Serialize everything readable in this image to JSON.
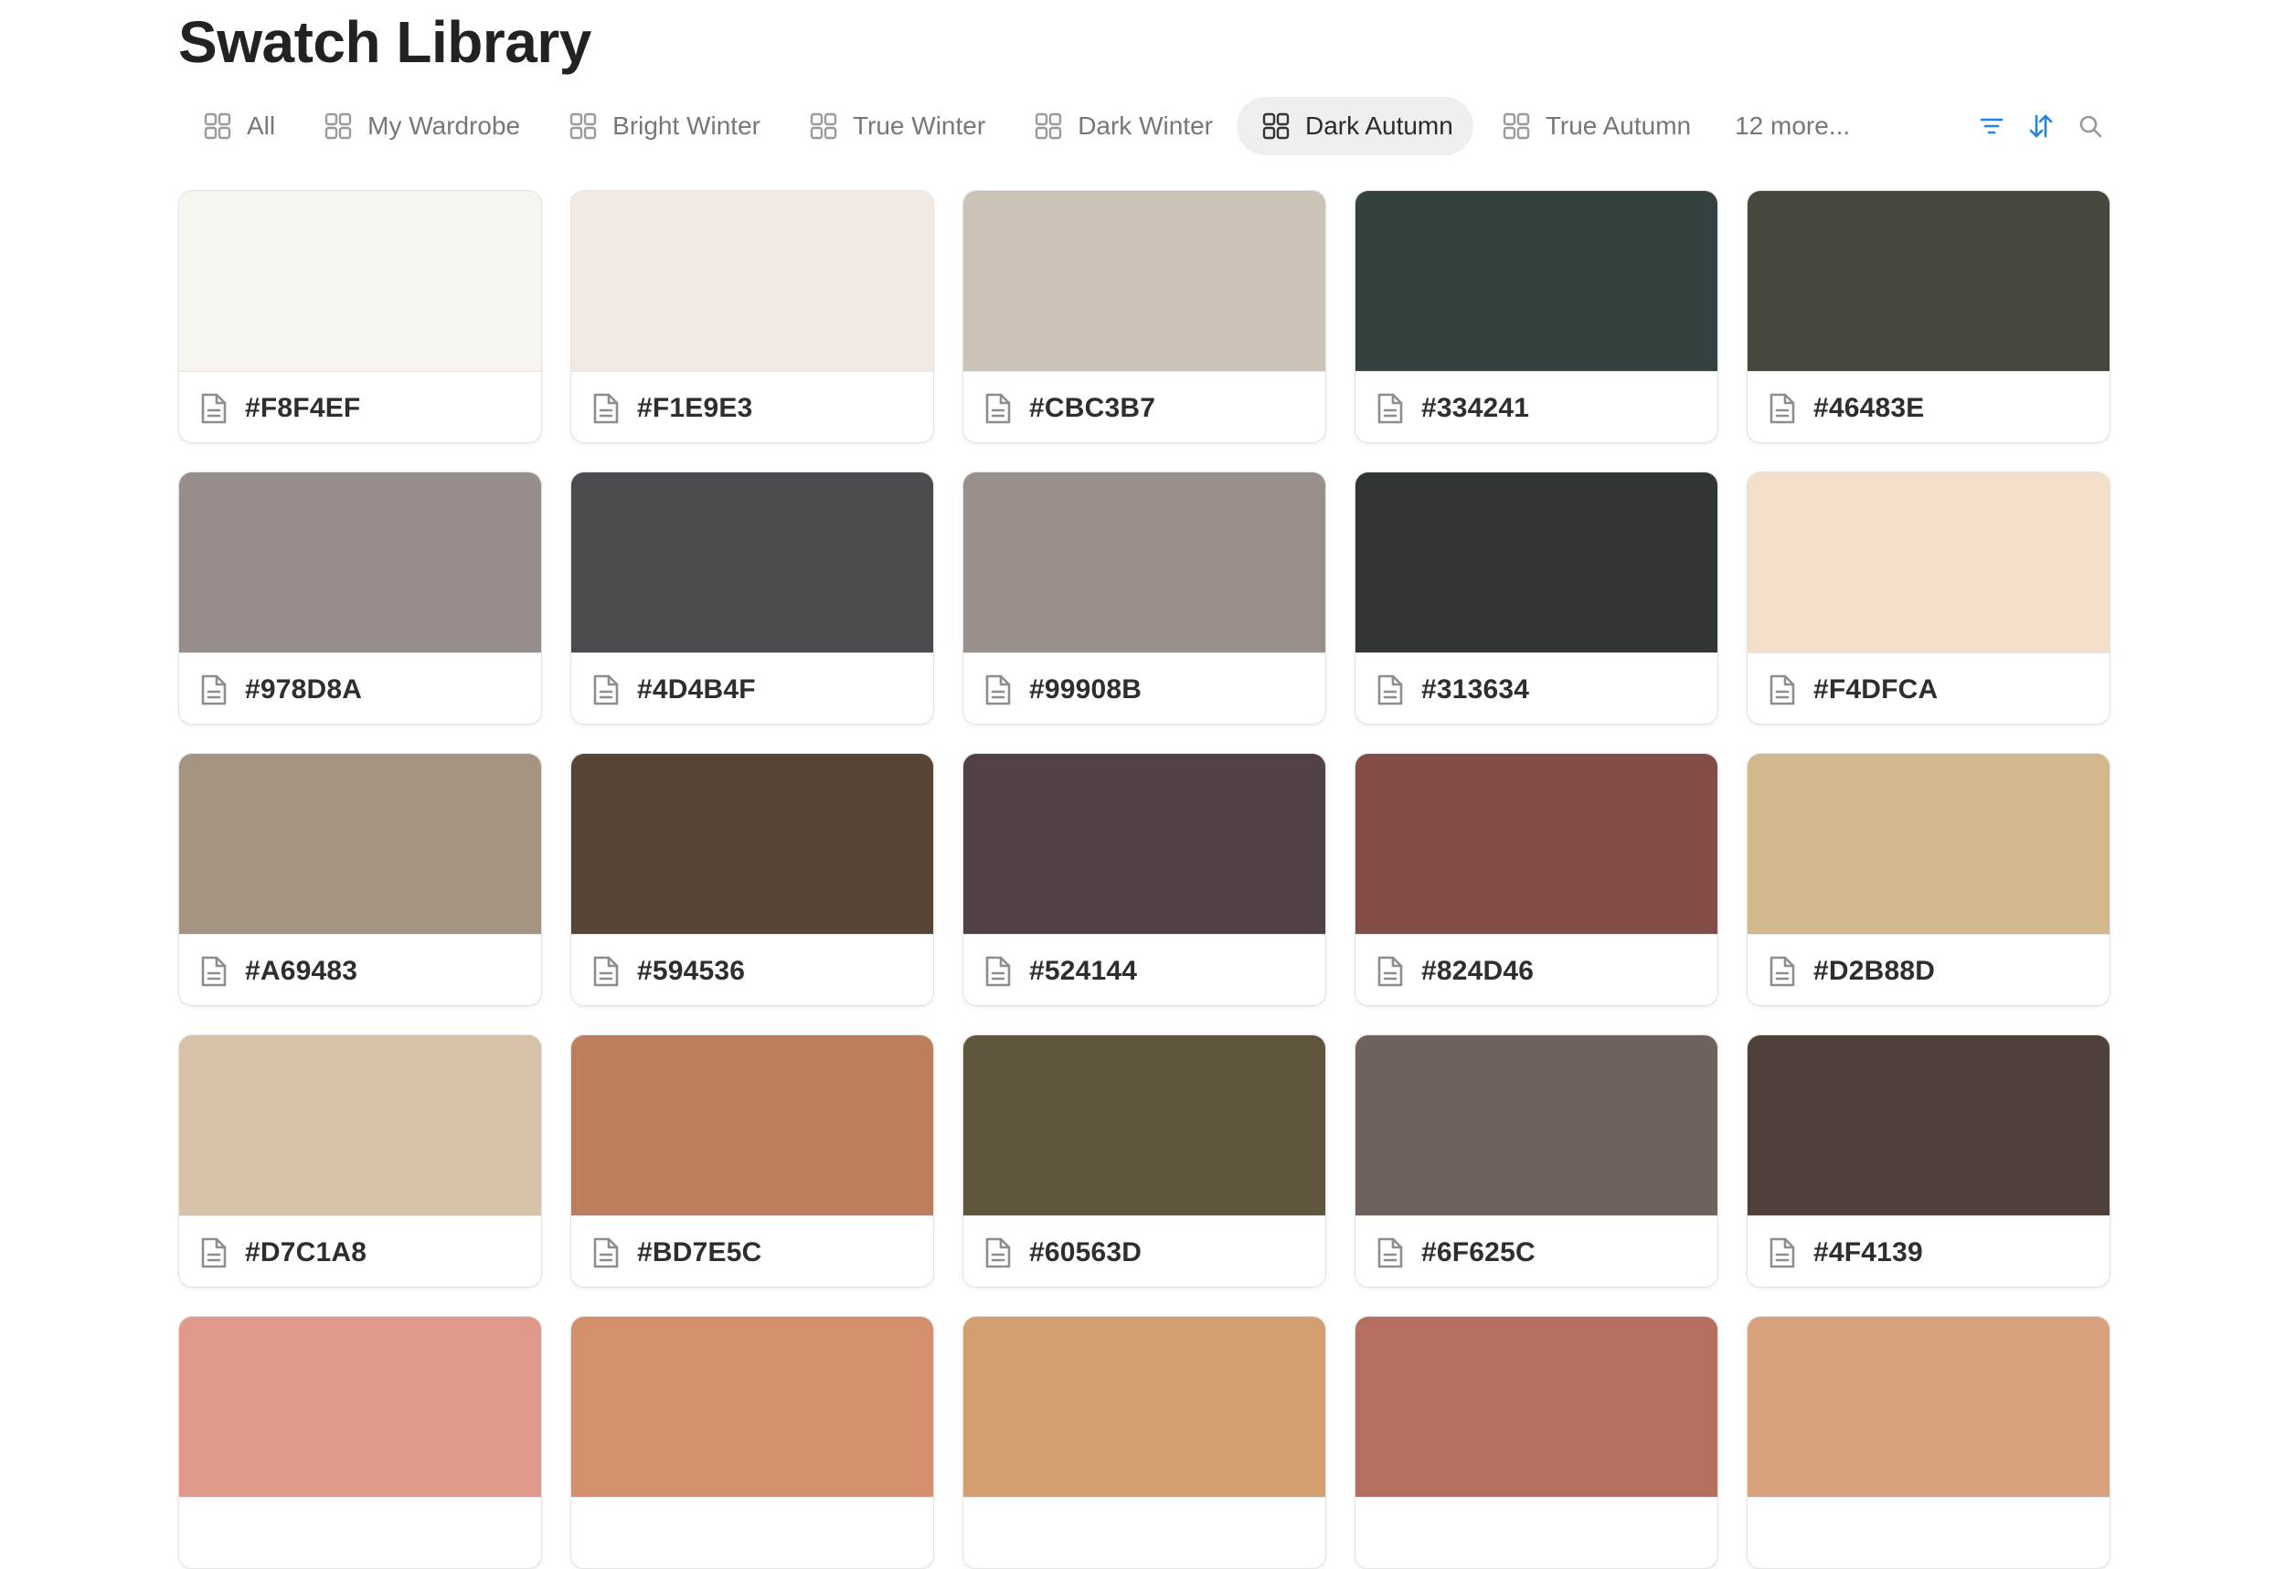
{
  "page": {
    "title": "Swatch Library"
  },
  "views": {
    "tabs": [
      {
        "label": "All",
        "icon": "gallery-grid-icon",
        "active": false
      },
      {
        "label": "My Wardrobe",
        "icon": "gallery-grid-icon",
        "active": false
      },
      {
        "label": "Bright Winter",
        "icon": "gallery-grid-icon",
        "active": false
      },
      {
        "label": "True Winter",
        "icon": "gallery-grid-icon",
        "active": false
      },
      {
        "label": "Dark Winter",
        "icon": "gallery-grid-icon",
        "active": false
      },
      {
        "label": "Dark Autumn",
        "icon": "gallery-grid-icon",
        "active": true
      },
      {
        "label": "True Autumn",
        "icon": "gallery-grid-icon",
        "active": false
      }
    ],
    "more_label": "12 more...",
    "actions": [
      {
        "name": "filter-icon",
        "color": "#2383e2"
      },
      {
        "name": "sort-icon",
        "color": "#2383e2"
      },
      {
        "name": "search-icon",
        "color": "#9b9a97"
      }
    ]
  },
  "swatches": [
    {
      "hex": "#F8F4EF",
      "color": "#F8F4EF"
    },
    {
      "hex": "#F1E9E3",
      "color": "#F1E9E3"
    },
    {
      "hex": "#CBC3B7",
      "color": "#CBC3B7"
    },
    {
      "hex": "#334241",
      "color": "#334241"
    },
    {
      "hex": "#46483E",
      "color": "#46483E"
    },
    {
      "hex": "#978D8A",
      "color": "#978D8A"
    },
    {
      "hex": "#4D4B4F",
      "color": "#4D4B4F"
    },
    {
      "hex": "#99908B",
      "color": "#99908B"
    },
    {
      "hex": "#313634",
      "color": "#313634"
    },
    {
      "hex": "#F4DFCA",
      "color": "#F4DFCA"
    },
    {
      "hex": "#A69483",
      "color": "#A69483"
    },
    {
      "hex": "#594536",
      "color": "#594536"
    },
    {
      "hex": "#524144",
      "color": "#524144"
    },
    {
      "hex": "#824D46",
      "color": "#824D46"
    },
    {
      "hex": "#D2B88D",
      "color": "#D2B88D"
    },
    {
      "hex": "#D7C1A8",
      "color": "#D7C1A8"
    },
    {
      "hex": "#BD7E5C",
      "color": "#BD7E5C"
    },
    {
      "hex": "#60563D",
      "color": "#60563D"
    },
    {
      "hex": "#6F625C",
      "color": "#6F625C"
    },
    {
      "hex": "#4F4139",
      "color": "#4F4139"
    },
    {
      "color": "#E0998B"
    },
    {
      "color": "#D4906C"
    },
    {
      "color": "#D39E70"
    },
    {
      "color": "#B66E60"
    },
    {
      "color": "#D9A27E"
    }
  ]
}
